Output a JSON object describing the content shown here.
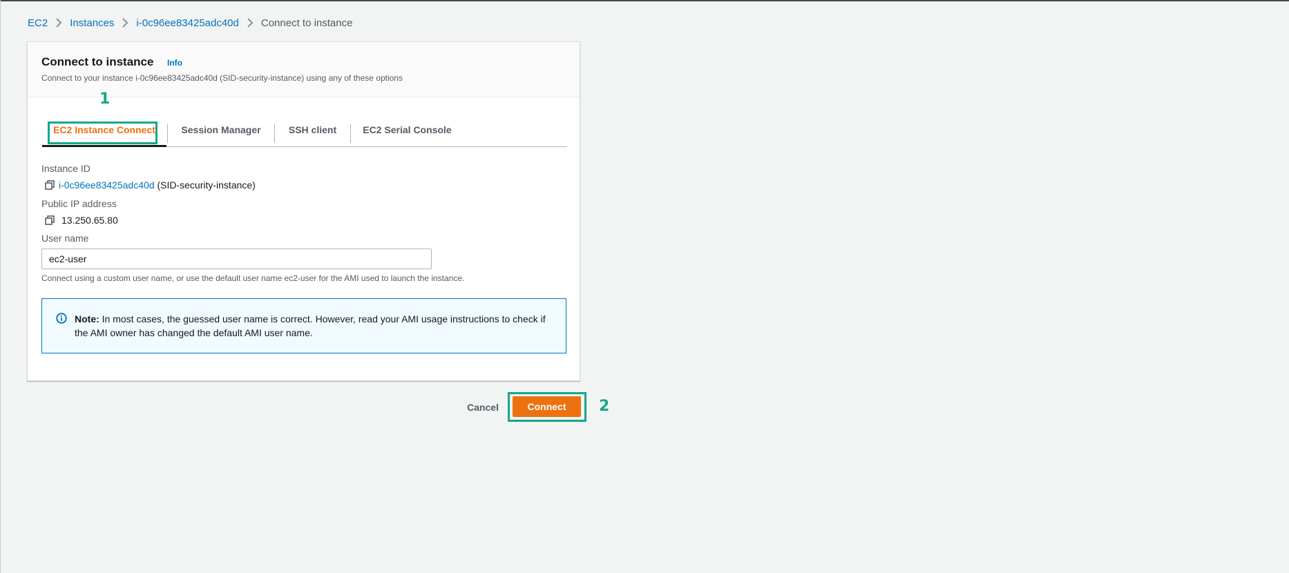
{
  "breadcrumb": {
    "items": [
      "EC2",
      "Instances",
      "i-0c96ee83425adc40d"
    ],
    "current": "Connect to instance"
  },
  "panel": {
    "title": "Connect to instance",
    "info_label": "Info",
    "description": "Connect to your instance i-0c96ee83425adc40d (SID-security-instance) using any of these options"
  },
  "tabs": [
    {
      "label": "EC2 Instance Connect",
      "active": true
    },
    {
      "label": "Session Manager",
      "active": false
    },
    {
      "label": "SSH client",
      "active": false
    },
    {
      "label": "EC2 Serial Console",
      "active": false
    }
  ],
  "fields": {
    "instance_id": {
      "label": "Instance ID",
      "value_link": "i-0c96ee83425adc40d",
      "value_suffix": " (SID-security-instance)",
      "icon": "copy-icon"
    },
    "public_ip": {
      "label": "Public IP address",
      "value": "13.250.65.80",
      "icon": "copy-icon"
    },
    "user_name": {
      "label": "User name",
      "value": "ec2-user",
      "help": "Connect using a custom user name, or use the default user name ec2-user for the AMI used to launch the instance."
    }
  },
  "alert": {
    "icon": "info-icon",
    "bold": "Note:",
    "text": " In most cases, the guessed user name is correct. However, read your AMI usage instructions to check if the AMI owner has changed the default AMI user name."
  },
  "footer": {
    "cancel_label": "Cancel",
    "connect_label": "Connect"
  },
  "annotations": {
    "step1": "1",
    "step2": "2"
  },
  "colors": {
    "accent": "#ec7211",
    "link": "#0073bb",
    "annotation": "#13a88a",
    "background": "#f2f3f3"
  }
}
